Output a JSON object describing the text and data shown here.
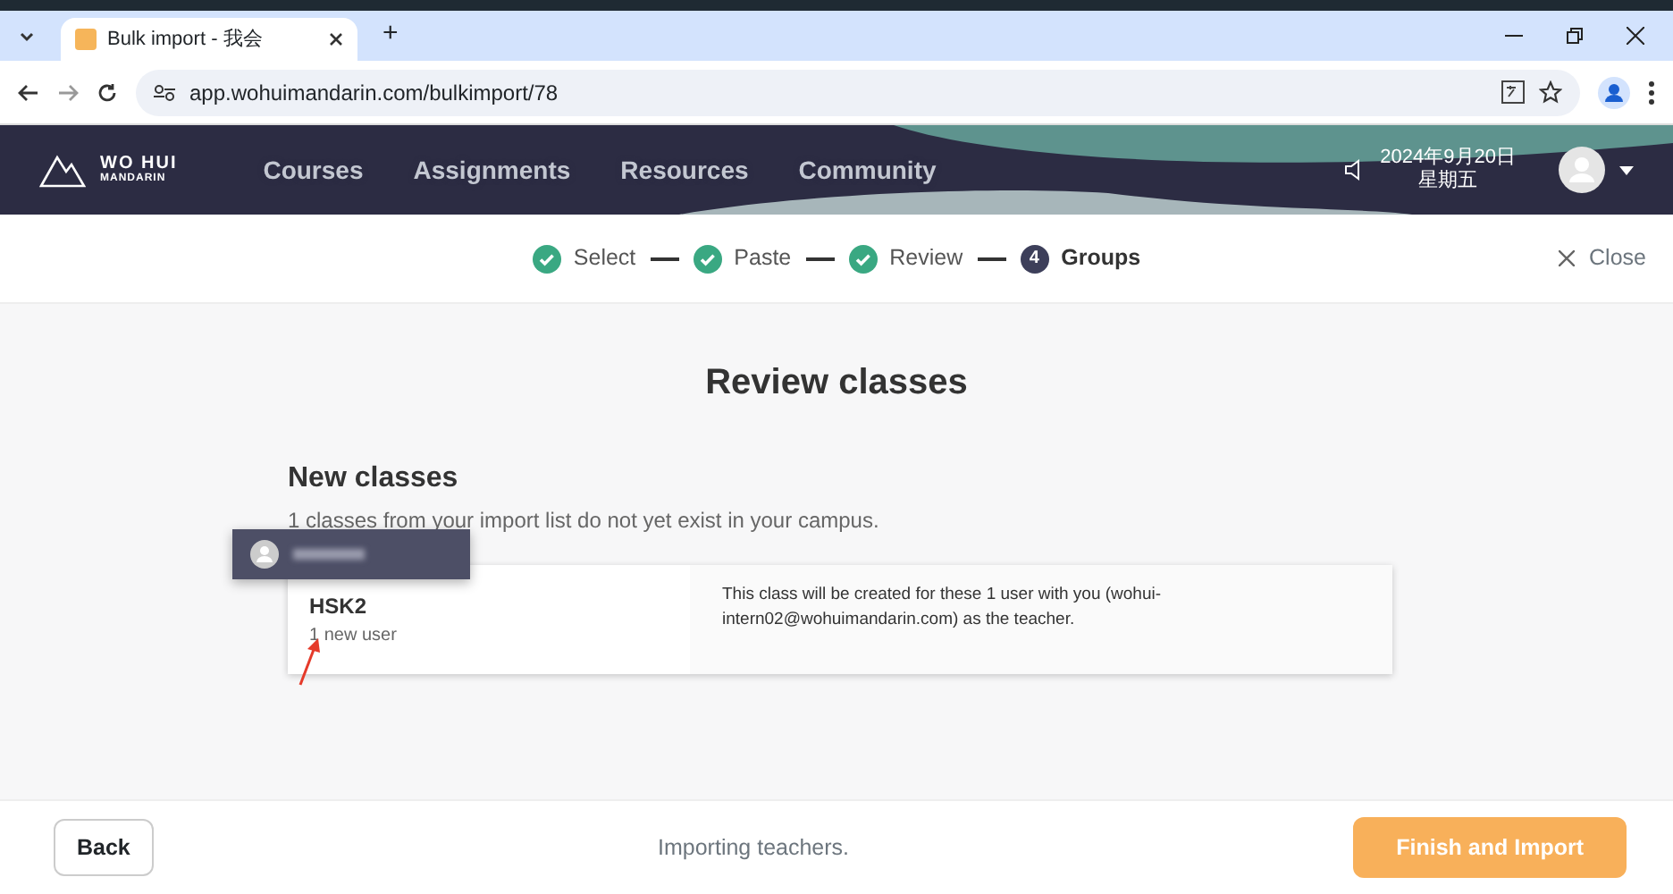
{
  "browser": {
    "tab_title": "Bulk import - 我会",
    "new_tab": "+",
    "url": "app.wohuimandarin.com/bulkimport/78"
  },
  "navbar": {
    "logo_line1": "WO HUI",
    "logo_line2": "MANDARIN",
    "links": [
      "Courses",
      "Assignments",
      "Resources",
      "Community"
    ],
    "date": "2024年9月20日",
    "weekday": "星期五"
  },
  "steps": [
    {
      "label": "Select",
      "completed": true
    },
    {
      "label": "Paste",
      "completed": true
    },
    {
      "label": "Review",
      "completed": true
    },
    {
      "label": "Groups",
      "completed": false,
      "number": "4"
    }
  ],
  "close": "Close",
  "heading": "Review classes",
  "section": {
    "title": "New classes",
    "subtitle": "1 classes from your import list do not yet exist in your campus.",
    "classes": [
      {
        "name": "HSK2",
        "count": "1 new user",
        "description": "This class will be created for these 1  user with you (wohui-intern02@wohuimandarin.com) as the teacher."
      }
    ]
  },
  "footer": {
    "back": "Back",
    "status": "Importing teachers.",
    "finish": "Finish and Import"
  }
}
